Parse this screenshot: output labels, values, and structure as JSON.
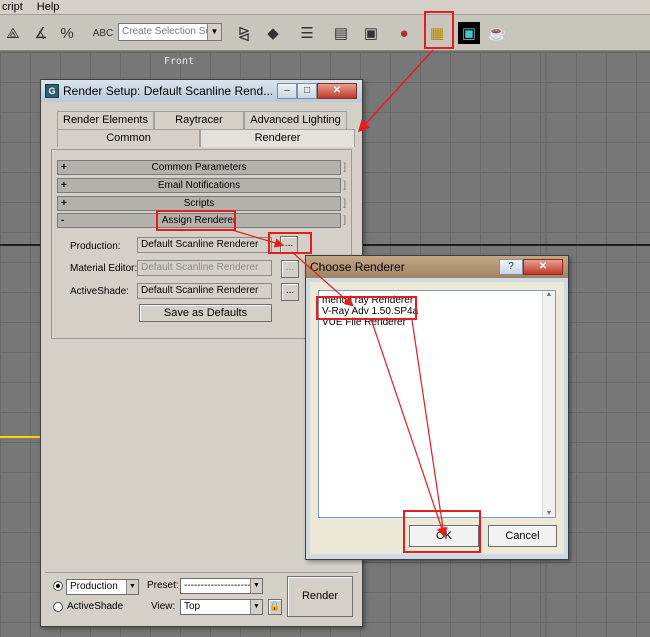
{
  "menubar": {
    "items": [
      "cript",
      "Help"
    ]
  },
  "toolbar": {
    "selection_set_placeholder": "Create Selection Set",
    "icons": [
      "select-object-icon",
      "angle-snap-icon",
      "percent-snap-icon",
      "spinner-snap-icon",
      "named-selection-icon",
      "mirror-icon",
      "align-icon",
      "layer-manager-icon",
      "track-view-icon",
      "schematic-view-icon",
      "material-editor-icon",
      "render-setup-icon",
      "rendered-frame-window-icon",
      "render-teapot-icon"
    ]
  },
  "viewport": {
    "front_label": "Front"
  },
  "render_setup": {
    "title": "Render Setup: Default Scanline Rend...",
    "tabs_row1": [
      "Render Elements",
      "Raytracer",
      "Advanced Lighting"
    ],
    "tabs_row2": [
      "Common",
      "Renderer"
    ],
    "rollouts": [
      {
        "sign": "+",
        "label": "Common Parameters"
      },
      {
        "sign": "+",
        "label": "Email Notifications"
      },
      {
        "sign": "+",
        "label": "Scripts"
      },
      {
        "sign": "-",
        "label": "Assign Renderer"
      }
    ],
    "production_label": "Production:",
    "production_value": "Default Scanline Renderer",
    "material_editor_label": "Material Editor:",
    "material_editor_value": "Default Scanline Renderer",
    "activeshade_label": "ActiveShade:",
    "activeshade_value": "Default Scanline Renderer",
    "ellipsis": "...",
    "save_defaults": "Save as Defaults",
    "mode_production": "Production",
    "mode_activeshade": "ActiveShade",
    "preset_label": "Preset:",
    "preset_value": "----------------------",
    "view_label": "View:",
    "view_value": "Top",
    "render_button": "Render"
  },
  "choose_renderer": {
    "title": "Choose Renderer",
    "help": "?",
    "items": [
      "mental ray Renderer",
      "V-Ray Adv 1.50.SP4a",
      "VUE File Renderer"
    ],
    "ok": "OK",
    "cancel": "Cancel"
  },
  "colors": {
    "annotation": "#e41e1e"
  }
}
